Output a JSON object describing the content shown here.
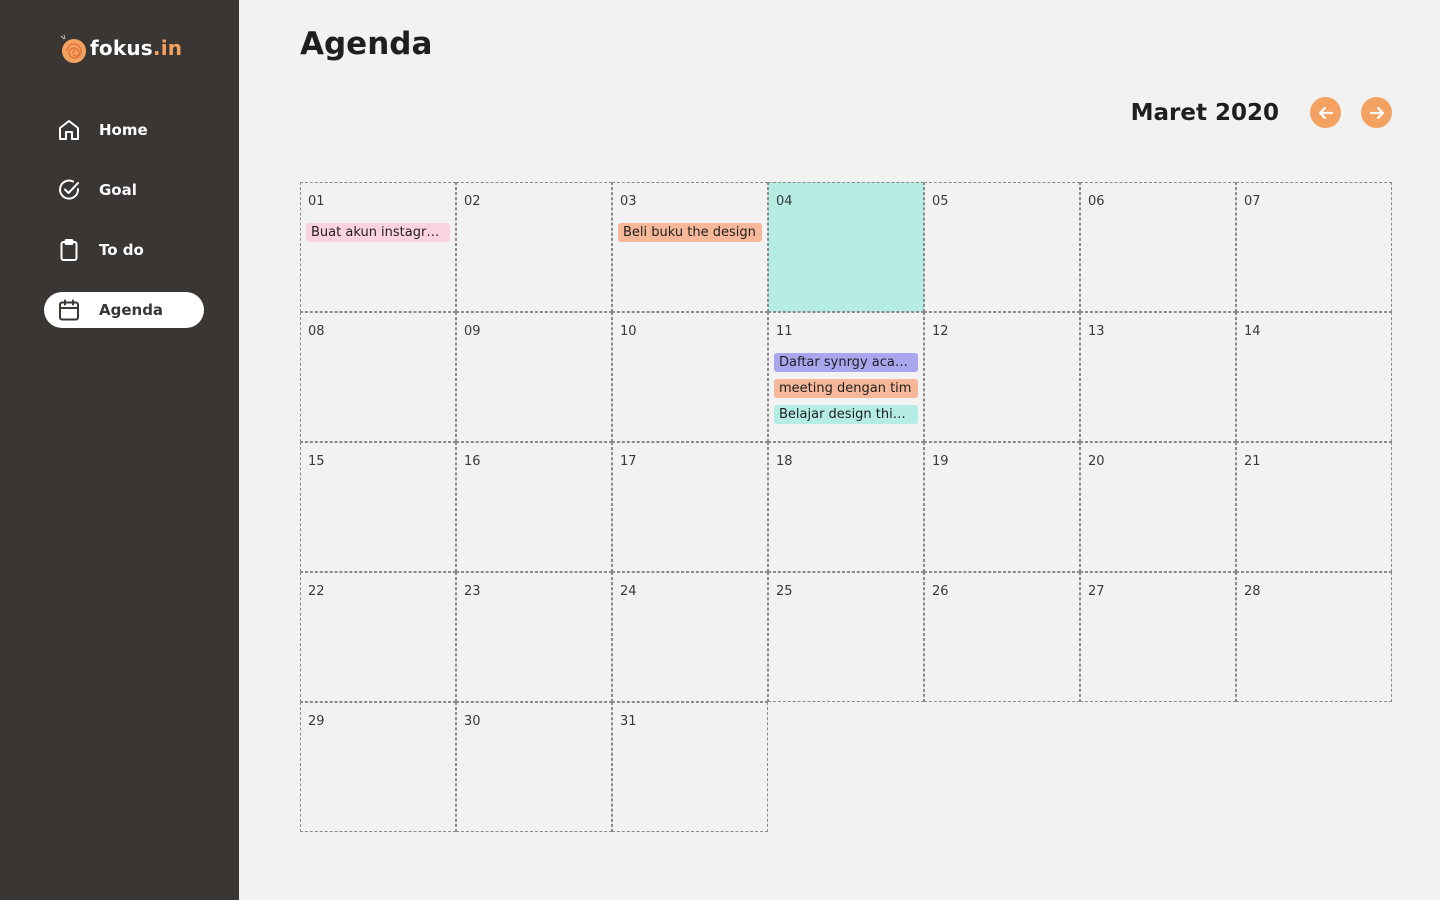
{
  "app": {
    "logo_text": "fokus",
    "logo_suffix": ".in"
  },
  "sidebar": {
    "items": [
      {
        "label": "Home",
        "icon": "home-icon",
        "active": false
      },
      {
        "label": "Goal",
        "icon": "check-circle-icon",
        "active": false
      },
      {
        "label": "To do",
        "icon": "clipboard-icon",
        "active": false
      },
      {
        "label": "Agenda",
        "icon": "calendar-icon",
        "active": true
      }
    ]
  },
  "page": {
    "title": "Agenda"
  },
  "calendar": {
    "month_label": "Maret 2020",
    "prev_icon": "arrow-left-icon",
    "next_icon": "arrow-right-icon",
    "today": "04",
    "days": [
      {
        "num": "01",
        "events": [
          {
            "text": "Buat akun instagram",
            "color": "pink"
          }
        ]
      },
      {
        "num": "02",
        "events": []
      },
      {
        "num": "03",
        "events": [
          {
            "text": "Beli buku the design",
            "color": "orange"
          }
        ]
      },
      {
        "num": "04",
        "events": []
      },
      {
        "num": "05",
        "events": []
      },
      {
        "num": "06",
        "events": []
      },
      {
        "num": "07",
        "events": []
      },
      {
        "num": "08",
        "events": []
      },
      {
        "num": "09",
        "events": []
      },
      {
        "num": "10",
        "events": []
      },
      {
        "num": "11",
        "events": [
          {
            "text": "Daftar synrgy academy",
            "color": "purple"
          },
          {
            "text": "meeting dengan tim",
            "color": "orange"
          },
          {
            "text": "Belajar design thinking",
            "color": "teal"
          }
        ]
      },
      {
        "num": "12",
        "events": []
      },
      {
        "num": "13",
        "events": []
      },
      {
        "num": "14",
        "events": []
      },
      {
        "num": "15",
        "events": []
      },
      {
        "num": "16",
        "events": []
      },
      {
        "num": "17",
        "events": []
      },
      {
        "num": "18",
        "events": []
      },
      {
        "num": "19",
        "events": []
      },
      {
        "num": "20",
        "events": []
      },
      {
        "num": "21",
        "events": []
      },
      {
        "num": "22",
        "events": []
      },
      {
        "num": "23",
        "events": []
      },
      {
        "num": "24",
        "events": []
      },
      {
        "num": "25",
        "events": []
      },
      {
        "num": "26",
        "events": []
      },
      {
        "num": "27",
        "events": []
      },
      {
        "num": "28",
        "events": []
      },
      {
        "num": "29",
        "events": []
      },
      {
        "num": "30",
        "events": []
      },
      {
        "num": "31",
        "events": []
      }
    ]
  },
  "colors": {
    "sidebar_bg": "#3a3633",
    "accent": "#f4a261",
    "today_bg": "#b5ece4",
    "event_pink": "#fbd3e0",
    "event_orange": "#f6b899",
    "event_purple": "#a9a5ee",
    "event_teal": "#b5ece4"
  }
}
